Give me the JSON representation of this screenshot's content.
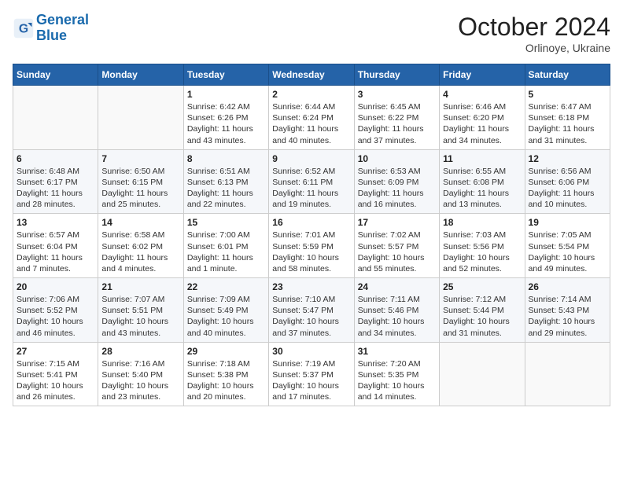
{
  "header": {
    "logo_line1": "General",
    "logo_line2": "Blue",
    "month": "October 2024",
    "location": "Orlinoye, Ukraine"
  },
  "columns": [
    "Sunday",
    "Monday",
    "Tuesday",
    "Wednesday",
    "Thursday",
    "Friday",
    "Saturday"
  ],
  "weeks": [
    [
      {
        "day": "",
        "info": ""
      },
      {
        "day": "",
        "info": ""
      },
      {
        "day": "1",
        "info": "Sunrise: 6:42 AM\nSunset: 6:26 PM\nDaylight: 11 hours and 43 minutes."
      },
      {
        "day": "2",
        "info": "Sunrise: 6:44 AM\nSunset: 6:24 PM\nDaylight: 11 hours and 40 minutes."
      },
      {
        "day": "3",
        "info": "Sunrise: 6:45 AM\nSunset: 6:22 PM\nDaylight: 11 hours and 37 minutes."
      },
      {
        "day": "4",
        "info": "Sunrise: 6:46 AM\nSunset: 6:20 PM\nDaylight: 11 hours and 34 minutes."
      },
      {
        "day": "5",
        "info": "Sunrise: 6:47 AM\nSunset: 6:18 PM\nDaylight: 11 hours and 31 minutes."
      }
    ],
    [
      {
        "day": "6",
        "info": "Sunrise: 6:48 AM\nSunset: 6:17 PM\nDaylight: 11 hours and 28 minutes."
      },
      {
        "day": "7",
        "info": "Sunrise: 6:50 AM\nSunset: 6:15 PM\nDaylight: 11 hours and 25 minutes."
      },
      {
        "day": "8",
        "info": "Sunrise: 6:51 AM\nSunset: 6:13 PM\nDaylight: 11 hours and 22 minutes."
      },
      {
        "day": "9",
        "info": "Sunrise: 6:52 AM\nSunset: 6:11 PM\nDaylight: 11 hours and 19 minutes."
      },
      {
        "day": "10",
        "info": "Sunrise: 6:53 AM\nSunset: 6:09 PM\nDaylight: 11 hours and 16 minutes."
      },
      {
        "day": "11",
        "info": "Sunrise: 6:55 AM\nSunset: 6:08 PM\nDaylight: 11 hours and 13 minutes."
      },
      {
        "day": "12",
        "info": "Sunrise: 6:56 AM\nSunset: 6:06 PM\nDaylight: 11 hours and 10 minutes."
      }
    ],
    [
      {
        "day": "13",
        "info": "Sunrise: 6:57 AM\nSunset: 6:04 PM\nDaylight: 11 hours and 7 minutes."
      },
      {
        "day": "14",
        "info": "Sunrise: 6:58 AM\nSunset: 6:02 PM\nDaylight: 11 hours and 4 minutes."
      },
      {
        "day": "15",
        "info": "Sunrise: 7:00 AM\nSunset: 6:01 PM\nDaylight: 11 hours and 1 minute."
      },
      {
        "day": "16",
        "info": "Sunrise: 7:01 AM\nSunset: 5:59 PM\nDaylight: 10 hours and 58 minutes."
      },
      {
        "day": "17",
        "info": "Sunrise: 7:02 AM\nSunset: 5:57 PM\nDaylight: 10 hours and 55 minutes."
      },
      {
        "day": "18",
        "info": "Sunrise: 7:03 AM\nSunset: 5:56 PM\nDaylight: 10 hours and 52 minutes."
      },
      {
        "day": "19",
        "info": "Sunrise: 7:05 AM\nSunset: 5:54 PM\nDaylight: 10 hours and 49 minutes."
      }
    ],
    [
      {
        "day": "20",
        "info": "Sunrise: 7:06 AM\nSunset: 5:52 PM\nDaylight: 10 hours and 46 minutes."
      },
      {
        "day": "21",
        "info": "Sunrise: 7:07 AM\nSunset: 5:51 PM\nDaylight: 10 hours and 43 minutes."
      },
      {
        "day": "22",
        "info": "Sunrise: 7:09 AM\nSunset: 5:49 PM\nDaylight: 10 hours and 40 minutes."
      },
      {
        "day": "23",
        "info": "Sunrise: 7:10 AM\nSunset: 5:47 PM\nDaylight: 10 hours and 37 minutes."
      },
      {
        "day": "24",
        "info": "Sunrise: 7:11 AM\nSunset: 5:46 PM\nDaylight: 10 hours and 34 minutes."
      },
      {
        "day": "25",
        "info": "Sunrise: 7:12 AM\nSunset: 5:44 PM\nDaylight: 10 hours and 31 minutes."
      },
      {
        "day": "26",
        "info": "Sunrise: 7:14 AM\nSunset: 5:43 PM\nDaylight: 10 hours and 29 minutes."
      }
    ],
    [
      {
        "day": "27",
        "info": "Sunrise: 7:15 AM\nSunset: 5:41 PM\nDaylight: 10 hours and 26 minutes."
      },
      {
        "day": "28",
        "info": "Sunrise: 7:16 AM\nSunset: 5:40 PM\nDaylight: 10 hours and 23 minutes."
      },
      {
        "day": "29",
        "info": "Sunrise: 7:18 AM\nSunset: 5:38 PM\nDaylight: 10 hours and 20 minutes."
      },
      {
        "day": "30",
        "info": "Sunrise: 7:19 AM\nSunset: 5:37 PM\nDaylight: 10 hours and 17 minutes."
      },
      {
        "day": "31",
        "info": "Sunrise: 7:20 AM\nSunset: 5:35 PM\nDaylight: 10 hours and 14 minutes."
      },
      {
        "day": "",
        "info": ""
      },
      {
        "day": "",
        "info": ""
      }
    ]
  ]
}
